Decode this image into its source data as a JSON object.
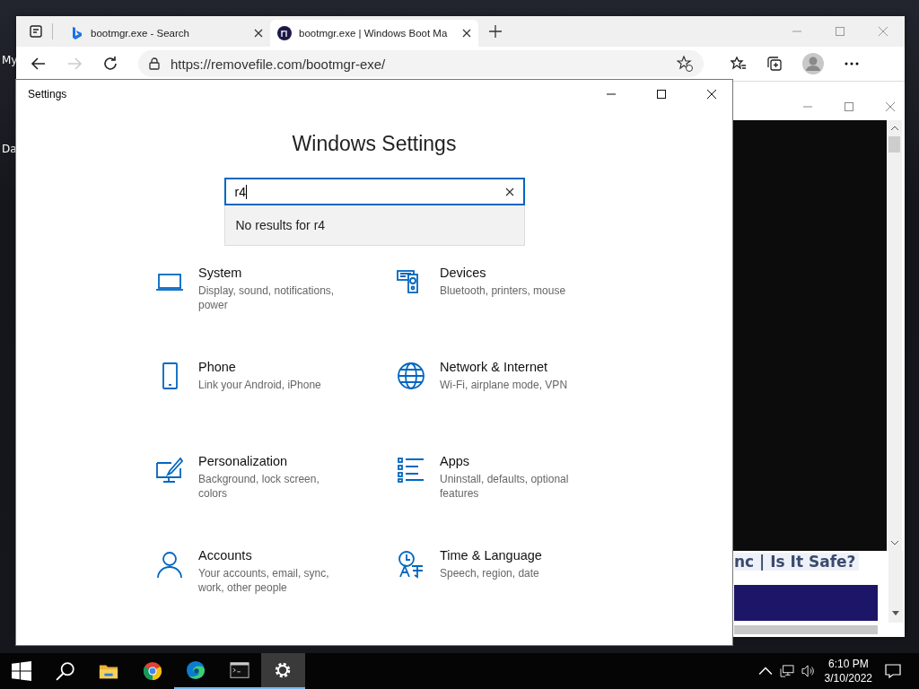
{
  "desktop": {
    "icons": [
      {
        "label": "My"
      },
      {
        "label": "Da"
      }
    ]
  },
  "browser": {
    "tabs": [
      {
        "title": "bootmgr.exe - Search",
        "kind": "bing",
        "selected": false
      },
      {
        "title": "bootmgr.exe | Windows Boot Ma",
        "kind": "site",
        "selected": true
      }
    ],
    "address": "https://removefile.com/bootmgr-exe/",
    "page_heading": "nc | Is It Safe?"
  },
  "settings": {
    "title": "Settings",
    "heading": "Windows Settings",
    "search": {
      "value": "r4",
      "result": "No results for r4"
    },
    "categories": [
      {
        "kind": "system",
        "name": "System",
        "description": "Display, sound, notifications, power"
      },
      {
        "kind": "devices",
        "name": "Devices",
        "description": "Bluetooth, printers, mouse"
      },
      {
        "kind": "phone",
        "name": "Phone",
        "description": "Link your Android, iPhone"
      },
      {
        "kind": "network",
        "name": "Network & Internet",
        "description": "Wi-Fi, airplane mode, VPN"
      },
      {
        "kind": "personalization",
        "name": "Personalization",
        "description": "Background, lock screen, colors"
      },
      {
        "kind": "apps",
        "name": "Apps",
        "description": "Uninstall, defaults, optional features"
      },
      {
        "kind": "accounts",
        "name": "Accounts",
        "description": "Your accounts, email, sync, work, other people"
      },
      {
        "kind": "time",
        "name": "Time & Language",
        "description": "Speech, region, date"
      }
    ]
  },
  "taskbar": {
    "apps": [
      {
        "kind": "explorer",
        "running": false,
        "selected": false
      },
      {
        "kind": "chrome",
        "running": false,
        "selected": false
      },
      {
        "kind": "edge",
        "running": true,
        "selected": false
      },
      {
        "kind": "terminal",
        "running": true,
        "selected": false
      },
      {
        "kind": "settings",
        "running": true,
        "selected": true
      }
    ],
    "time": "6:10 PM",
    "date": "3/10/2022"
  }
}
